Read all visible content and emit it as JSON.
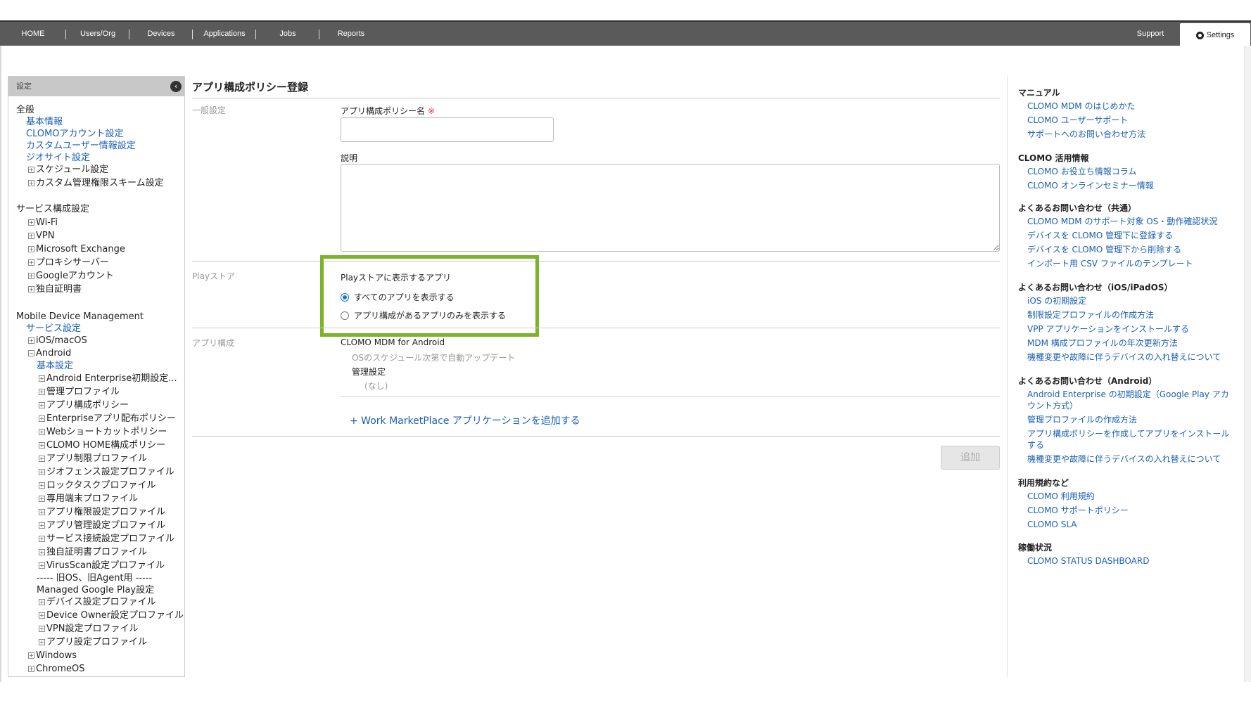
{
  "nav": {
    "items": [
      "HOME",
      "Users/Org",
      "Devices",
      "Applications",
      "Jobs",
      "Reports"
    ],
    "support": "Support",
    "settings": "Settings"
  },
  "sidebar": {
    "title": "設定",
    "general_title": "全般",
    "general": [
      "基本情報",
      "CLOMOアカウント設定",
      "カスタムユーザー情報設定",
      "ジオサイト設定"
    ],
    "general_expandable": [
      "スケジュール設定",
      "カスタム管理権限スキーム設定"
    ],
    "service_title": "サービス構成設定",
    "service": [
      "Wi-Fi",
      "VPN",
      "Microsoft Exchange",
      "プロキシサーバー",
      "Googleアカウント",
      "独自証明書"
    ],
    "mdm_title": "Mobile Device Management",
    "mdm_service_settings": "サービス設定",
    "ios": "iOS/macOS",
    "android": "Android",
    "android_basic": "基本設定",
    "android_items": [
      "Android Enterprise初期設定...",
      "管理プロファイル",
      "アプリ構成ポリシー",
      "Enterpriseアプリ配布ポリシー",
      "Webショートカットポリシー",
      "CLOMO HOME構成ポリシー",
      "アプリ制限プロファイル",
      "ジオフェンス設定プロファイル",
      "ロックタスクプロファイル",
      "専用端末プロファイル",
      "アプリ権限設定プロファイル",
      "アプリ管理設定プロファイル",
      "サービス接続設定プロファイル",
      "独自証明書プロファイル",
      "VirusScan設定プロファイル"
    ],
    "legacy_sep": "----- 旧OS、旧Agent用 -----",
    "managed_gp": "Managed Google Play設定",
    "legacy_items": [
      "デバイス設定プロファイル",
      "Device Owner設定プロファイル",
      "VPN設定プロファイル",
      "アプリ設定プロファイル"
    ],
    "windows": "Windows",
    "chromeos": "ChromeOS"
  },
  "main": {
    "title": "アプリ構成ポリシー登録",
    "general_section": "一般設定",
    "policy_name_label": "アプリ構成ポリシー名",
    "required_mark": "※",
    "policy_name_value": "",
    "description_label": "説明",
    "description_value": "",
    "play_section": "Playストア",
    "play_group_label": "Playストアに表示するアプリ",
    "radio_all": "すべてのアプリを表示する",
    "radio_configured": "アプリ構成があるアプリのみを表示する",
    "app_section": "アプリ構成",
    "app_name": "CLOMO MDM for Android",
    "app_update": "OSのスケジュール次第で自動アップデート",
    "managed_settings": "管理設定",
    "managed_value": "(なし)",
    "add_app_link": "+ Work MarketPlace アプリケーションを追加する",
    "add_button": "追加"
  },
  "right": {
    "manual_title": "マニュアル",
    "manual": [
      "CLOMO MDM のはじめかた",
      "CLOMO ユーザーサポート",
      "サポートへのお問い合わせ方法"
    ],
    "use_title": "CLOMO 活用情報",
    "use": [
      "CLOMO お役立ち情報コラム",
      "CLOMO オンラインセミナー情報"
    ],
    "faq_common_title": "よくあるお問い合わせ（共通）",
    "faq_common": [
      "CLOMO MDM のサポート対象 OS・動作確認状況",
      "デバイスを CLOMO 管理下に登録する",
      "デバイスを CLOMO 管理下から削除する",
      "インポート用 CSV ファイルのテンプレート"
    ],
    "faq_ios_title": "よくあるお問い合わせ（iOS/iPadOS）",
    "faq_ios": [
      "iOS の初期設定",
      "制限設定プロファイルの作成方法",
      "VPP アプリケーションをインストールする",
      "MDM 構成プロファイルの年次更新方法",
      "機種変更や故障に伴うデバイスの入れ替えについて"
    ],
    "faq_android_title": "よくあるお問い合わせ（Android）",
    "faq_android": [
      "Android Enterprise の初期設定（Google Play アカウント方式）",
      "管理プロファイルの作成方法",
      "アプリ構成ポリシーを作成してアプリをインストールする",
      "機種変更や故障に伴うデバイスの入れ替えについて"
    ],
    "terms_title": "利用規約など",
    "terms": [
      "CLOMO 利用規約",
      "CLOMO サポートポリシー",
      "CLOMO SLA"
    ],
    "status_title": "稼働状況",
    "status": [
      "CLOMO STATUS DASHBOARD"
    ]
  }
}
